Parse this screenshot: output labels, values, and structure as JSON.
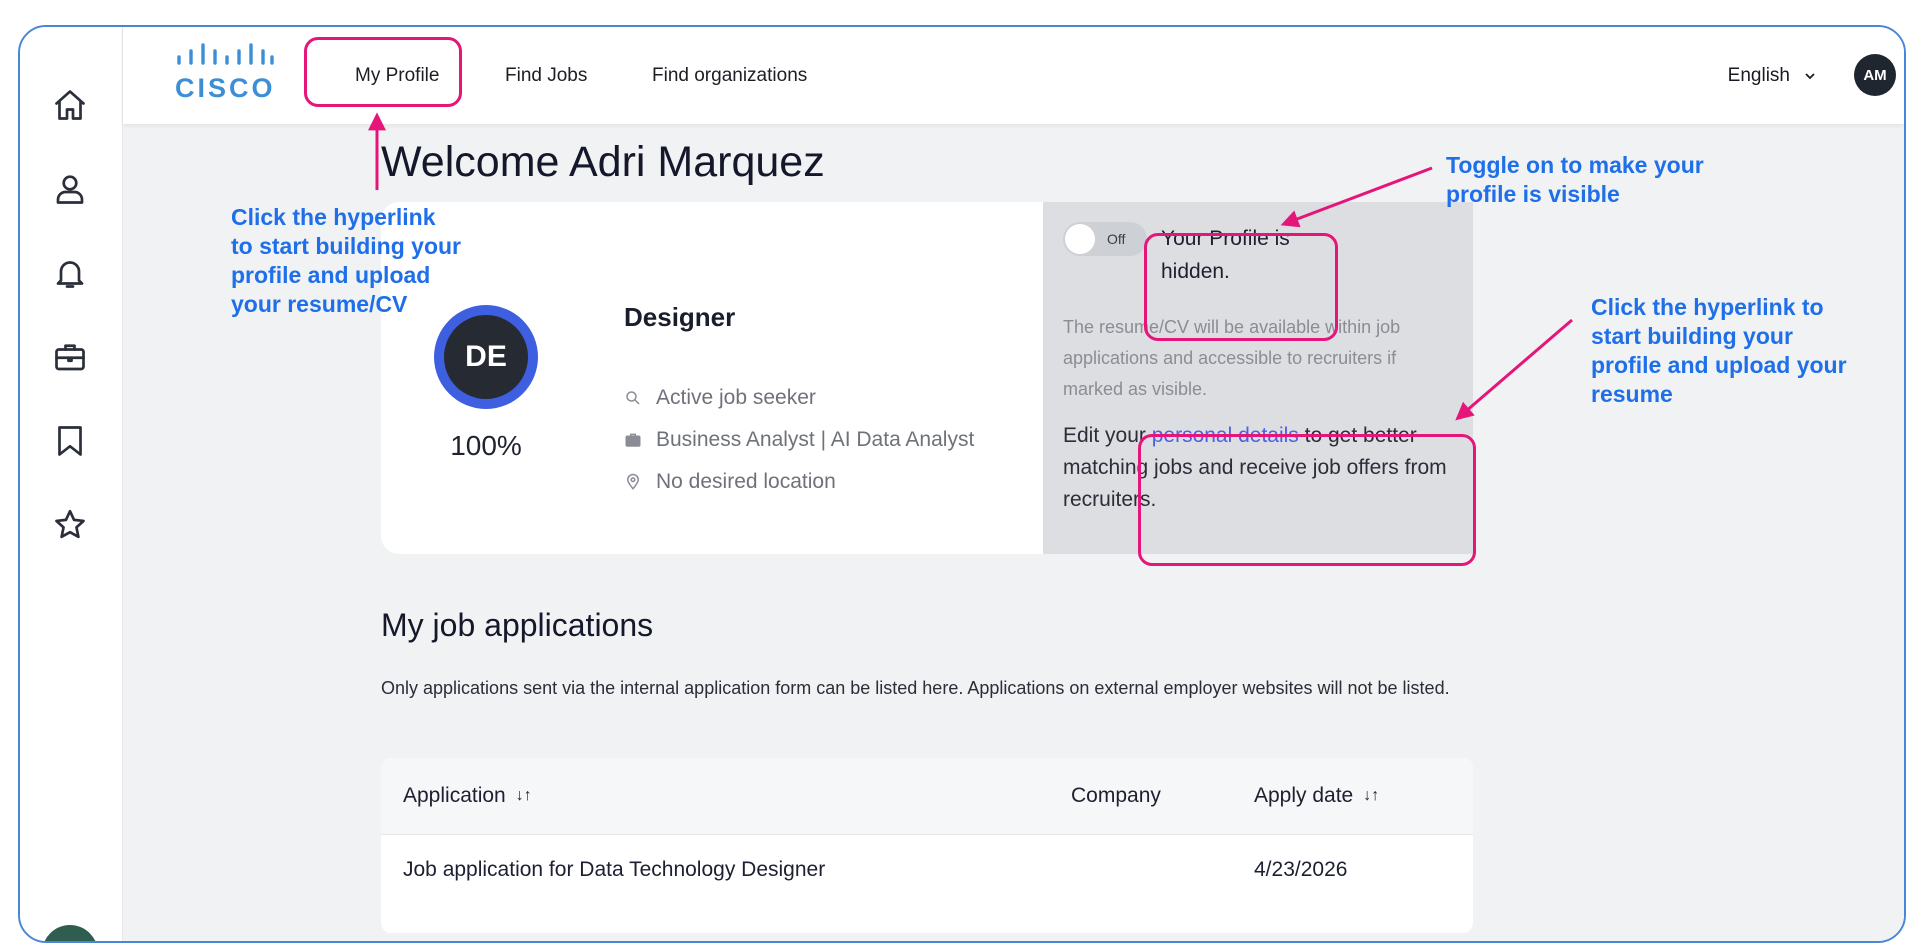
{
  "header": {
    "logo_text": "CISCO",
    "nav": [
      "My Profile",
      "Find Jobs",
      "Find organizations"
    ],
    "language": "English",
    "user_initials": "AM"
  },
  "sidebar": {
    "icons": [
      "home-icon",
      "user-icon",
      "bell-icon",
      "briefcase-icon",
      "bookmark-icon",
      "star-icon"
    ]
  },
  "welcome": "Welcome Adri Marquez",
  "profile": {
    "initials": "DE",
    "completion": "100%",
    "role": "Designer",
    "status": "Active job seeker",
    "positions": "Business Analyst | AI Data Analyst",
    "location": "No desired location"
  },
  "visibility": {
    "toggle_label": "Off",
    "status": "Your Profile is hidden.",
    "description": "The resume/CV will be available within job applications and accessible to recruiters if marked as visible.",
    "edit_prefix": "Edit your ",
    "edit_link": "personal details",
    "edit_suffix": " to get better matching jobs and receive job offers from recruiters."
  },
  "applications": {
    "title": "My job applications",
    "note": "Only applications sent via the internal application form can be listed here. Applications on external employer websites will not be listed.",
    "columns": [
      "Application",
      "Company",
      "Apply date"
    ],
    "sort_glyph": "↓↑",
    "rows": [
      {
        "application": "Job application for Data Technology Designer",
        "company": "",
        "date": "4/23/2026"
      }
    ]
  },
  "annotations": {
    "left": "Click the hyperlink to start building your profile and upload your resume/CV",
    "toggle": "Toggle on to make your profile is visible",
    "right": "Click the hyperlink to start building your profile and upload your resume"
  },
  "colors": {
    "callout": "#e5157a",
    "annotation_text": "#1e6fe8",
    "link": "#4a62e0",
    "avatar_ring": "#3d5fe0"
  }
}
